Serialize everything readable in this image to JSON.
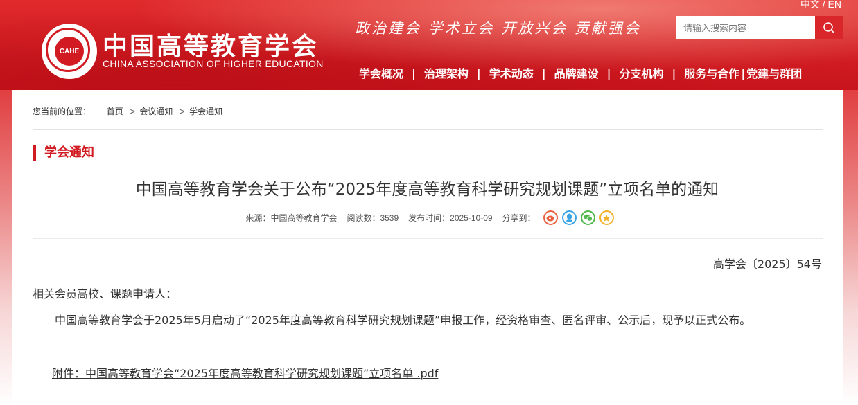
{
  "header": {
    "lang_switch": "中文 / EN",
    "logo_badge": "CAHE",
    "org_name": "中国高等教育学会",
    "org_name_en": "CHINA ASSOCIATION OF HIGHER EDUCATION",
    "slogan": "政治建会  学术立会  开放兴会  贡献强会",
    "search": {
      "placeholder": "请输入搜索内容",
      "icon": "search-icon"
    },
    "nav": [
      "学会概况",
      "治理架构",
      "学术动态",
      "品牌建设",
      "分支机构",
      "服务与合作",
      "党建与群团"
    ]
  },
  "breadcrumb": {
    "prefix": "您当前的位置：",
    "items": [
      "首页",
      "会议通知",
      "学会通知"
    ]
  },
  "section_title": "学会通知",
  "article": {
    "title": "中国高等教育学会关于公布“2025年度高等教育科学研究规划课题”立项名单的通知",
    "source": "来源：中国高等教育学会",
    "reads": "阅读数：3539",
    "date": "发布时间：2025-10-09",
    "share_label": "分享到：",
    "share_icons": [
      "weibo-icon",
      "qq-icon",
      "wechat-icon",
      "qzone-icon"
    ],
    "doc_number": "高学会〔2025〕54号",
    "salutation": "相关会员高校、课题申请人：",
    "paragraph": "中国高等教育学会于2025年5月启动了“2025年度高等教育科学研究规划课题”申报工作，经资格审查、匿名评审、公示后，现予以正式公布。",
    "attachment": "附件：中国高等教育学会“2025年度高等教育科学研究规划课题”立项名单 .pdf"
  },
  "colors": {
    "brand_red": "#d21a22",
    "text": "#333333"
  }
}
